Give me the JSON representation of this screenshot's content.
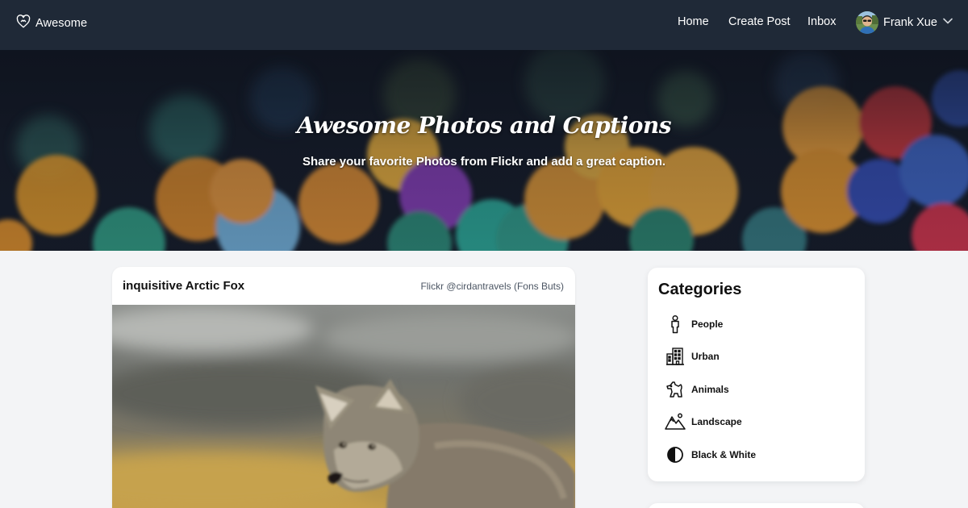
{
  "nav": {
    "brand": "Awesome",
    "brand_icon": "heart-icon",
    "links": [
      "Home",
      "Create Post",
      "Inbox"
    ],
    "user": {
      "name": "Frank Xue",
      "avatar_icon": "avatar"
    }
  },
  "hero": {
    "title": "Awesome Photos and Captions",
    "subtitle": "Share your favorite Photos from Flickr and add a great caption."
  },
  "post": {
    "title": "inquisitive Arctic Fox",
    "credit": "Flickr @cirdantravels (Fons Buts)"
  },
  "categories": {
    "heading": "Categories",
    "items": [
      {
        "label": "People",
        "icon": "person-icon"
      },
      {
        "label": "Urban",
        "icon": "building-icon"
      },
      {
        "label": "Animals",
        "icon": "dog-icon"
      },
      {
        "label": "Landscape",
        "icon": "mountains-icon"
      },
      {
        "label": "Black & White",
        "icon": "contrast-icon"
      }
    ]
  },
  "colors": {
    "navbar": "#1f2937",
    "page_bg": "#f3f4f6",
    "card_bg": "#ffffff"
  }
}
